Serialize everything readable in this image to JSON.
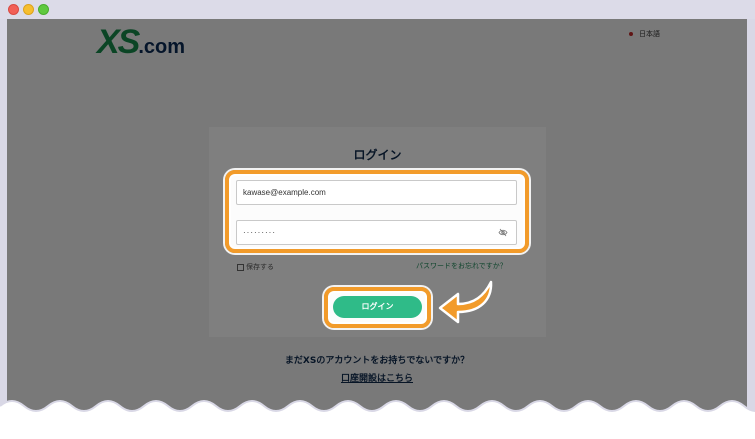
{
  "brand": {
    "logo_xs": "XS",
    "logo_com": ".com"
  },
  "language": {
    "label": "日本語"
  },
  "login": {
    "title": "ログイン",
    "email_value": "kawase@example.com",
    "password_value": "·········",
    "remember_label": "保存する",
    "forgot_label": "パスワードをお忘れですか？",
    "button_label": "ログイン"
  },
  "signup": {
    "question": "まだXSのアカウントをお持ちでないですか？",
    "link_label": "口座開設はこちら"
  },
  "colors": {
    "highlight": "#f29b2a",
    "button": "#2fbb88",
    "brand_green": "#178a4b",
    "brand_navy": "#0a2a55"
  },
  "icons": {
    "password_toggle": "eye-slash-icon",
    "callout_arrow": "arrow-icon"
  }
}
